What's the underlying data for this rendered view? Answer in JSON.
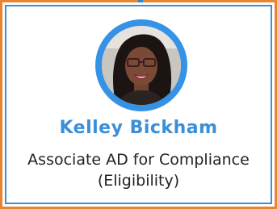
{
  "profile": {
    "name": "Kelley Bickham",
    "title_line1": "Associate AD for Compliance",
    "title_line2": "(Eligibility)",
    "avatar_icon": "person-photo-icon"
  },
  "colors": {
    "accent": "#3b8fd9",
    "frame": "#e8852e",
    "ring": "#3592e4",
    "text": "#222222"
  }
}
